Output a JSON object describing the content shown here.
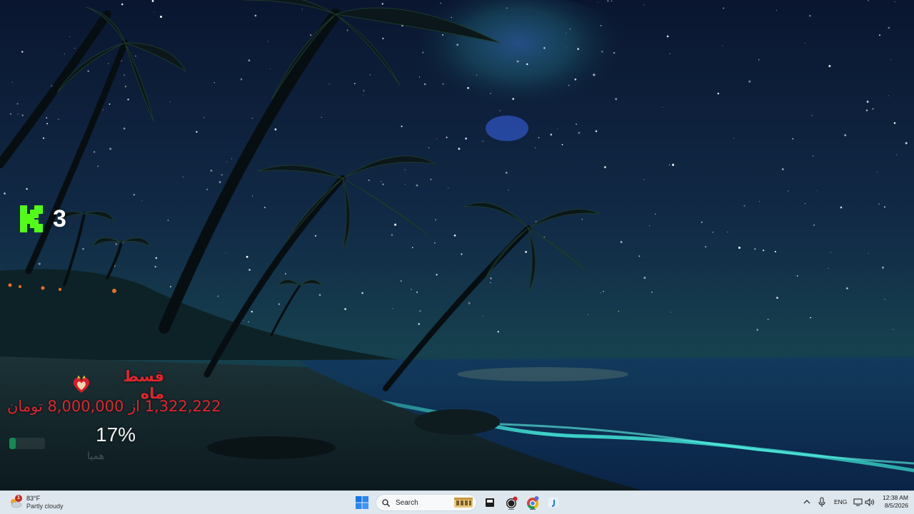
{
  "widgets": {
    "k_counter": {
      "icon": "kick-k-icon",
      "accent": "#53fc18",
      "value": "3"
    },
    "loan": {
      "title": "قسط ماه",
      "amount_text": "1,322,222 از 8,000,000 تومان",
      "progress": 0.17,
      "percent_text": "17%",
      "brand": "همیا",
      "accent": "#e0262f",
      "bar_color": "#138a55"
    }
  },
  "taskbar": {
    "weather": {
      "temp": "83°F",
      "condition": "Partly cloudy",
      "badge": "1"
    },
    "search": {
      "placeholder": "Search"
    },
    "apps": [
      "start-icon",
      "search-icon",
      "file-manager-icon",
      "obs-icon",
      "chrome-icon",
      "app-j-icon"
    ],
    "tray": {
      "language": "ENG"
    },
    "clock": {
      "time": "12:38 AM",
      "date": "8/5/2026"
    }
  }
}
